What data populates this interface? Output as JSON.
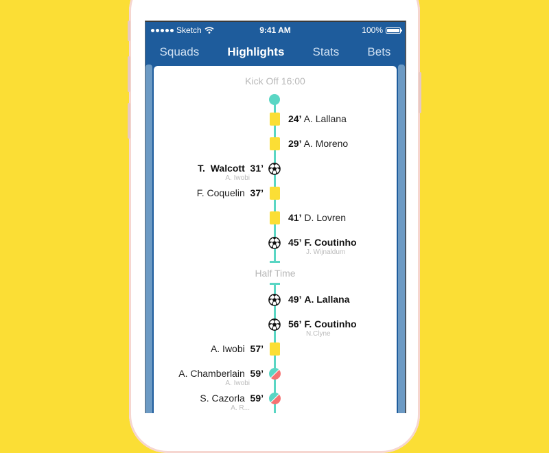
{
  "status_bar": {
    "carrier": "Sketch",
    "time": "9:41 AM",
    "battery": "100%",
    "battery_level_percent": 100
  },
  "tabs": [
    {
      "label": "Squads",
      "active": false
    },
    {
      "label": "Highlights",
      "active": true
    },
    {
      "label": "Stats",
      "active": false
    },
    {
      "label": "Bets",
      "active": false
    }
  ],
  "timeline": {
    "kickoff_label": "Kick Off 16:00",
    "halftime_label": "Half Time",
    "colors": {
      "line": "#5AD6C4",
      "yellow_card": "#FBDE35",
      "sub_in": "#5AD6C4",
      "sub_out": "#F57272",
      "header_blue": "#1E5C9C",
      "background_yellow": "#FBDE35"
    },
    "events": [
      {
        "side": "right",
        "type": "yellow-card",
        "minute": "24’",
        "player": "A. Lallana",
        "assist": ""
      },
      {
        "side": "right",
        "type": "yellow-card",
        "minute": "29’",
        "player": "A. Moreno",
        "assist": ""
      },
      {
        "side": "left",
        "type": "goal",
        "minute": "31’",
        "player": "T.  Walcott",
        "assist": "A. Iwobi"
      },
      {
        "side": "left",
        "type": "yellow-card",
        "minute": "37’",
        "player": "F. Coquelin",
        "assist": ""
      },
      {
        "side": "right",
        "type": "yellow-card",
        "minute": "41’",
        "player": "D. Lovren",
        "assist": ""
      },
      {
        "side": "right",
        "type": "goal",
        "minute": "45’",
        "player": "F. Coutinho",
        "assist": "J. Wijnaldum"
      },
      {
        "side": "right",
        "type": "goal",
        "minute": "49’",
        "player": "A. Lallana",
        "assist": ""
      },
      {
        "side": "right",
        "type": "goal",
        "minute": "56’",
        "player": "F. Coutinho",
        "assist": "N.Clyne"
      },
      {
        "side": "left",
        "type": "yellow-card",
        "minute": "57’",
        "player": "A. Iwobi",
        "assist": ""
      },
      {
        "side": "left",
        "type": "substitution",
        "minute": "59’",
        "player": "A. Chamberlain",
        "assist": "A. Iwobi"
      },
      {
        "side": "left",
        "type": "substitution",
        "minute": "59’",
        "player": "S. Cazorla",
        "assist": "A. R..."
      }
    ]
  }
}
